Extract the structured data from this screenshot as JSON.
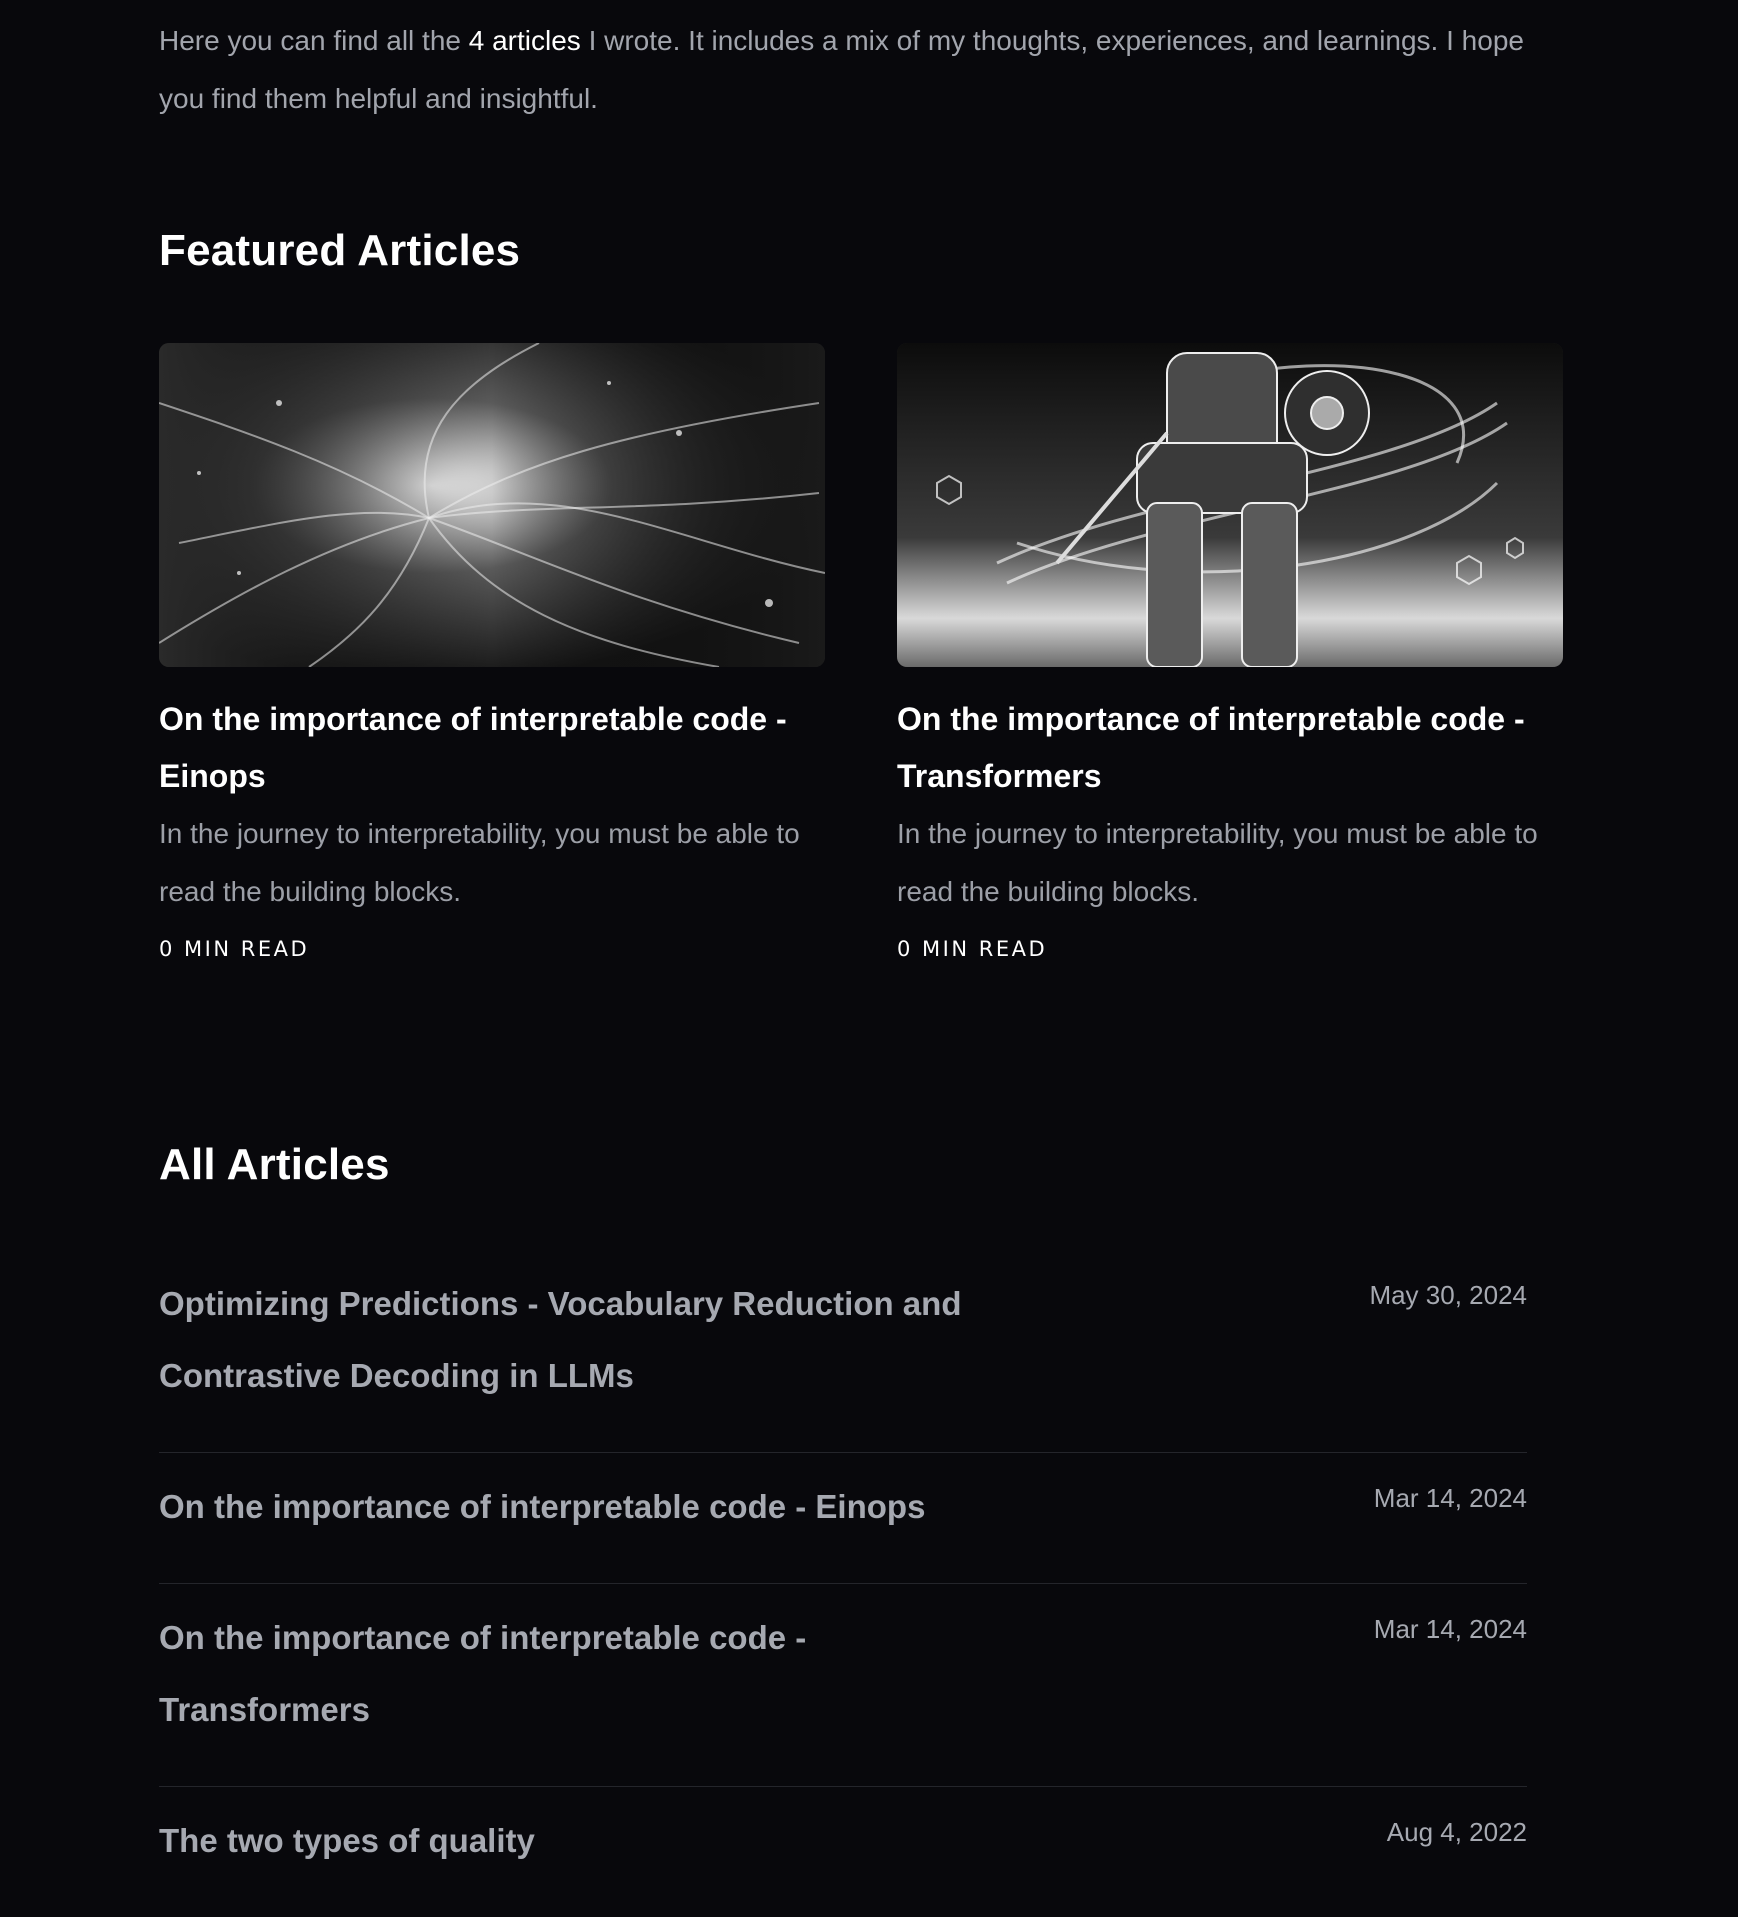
{
  "intro": {
    "before": "Here you can find all the ",
    "highlight": "4 articles",
    "after": " I wrote. It includes a mix of my thoughts, experiences, and learnings. I hope you find them helpful and insightful."
  },
  "featured": {
    "title": "Featured Articles",
    "cards": [
      {
        "title": "On the importance of interpretable code - Einops",
        "description": "In the journey to interpretability, you must be able to read the building blocks.",
        "meta": "0 MIN READ",
        "image_icon": "abstract-swirl-image"
      },
      {
        "title": "On the importance of interpretable code - Transformers",
        "description": "In the journey to interpretability, you must be able to read the building blocks.",
        "meta": "0 MIN READ",
        "image_icon": "robot-image"
      }
    ]
  },
  "all": {
    "title": "All Articles",
    "articles": [
      {
        "title": "Optimizing Predictions - Vocabulary Reduction and Contrastive Decoding in LLMs",
        "date": "May 30, 2024"
      },
      {
        "title": "On the importance of interpretable code - Einops",
        "date": "Mar 14, 2024"
      },
      {
        "title": "On the importance of interpretable code - Transformers",
        "date": "Mar 14, 2024"
      },
      {
        "title": "The two types of quality",
        "date": "Aug 4, 2022"
      }
    ]
  },
  "colors": {
    "background": "#08080c",
    "heading": "#ffffff",
    "muted_text": "#a2a5ad",
    "divider": "#24252b"
  }
}
